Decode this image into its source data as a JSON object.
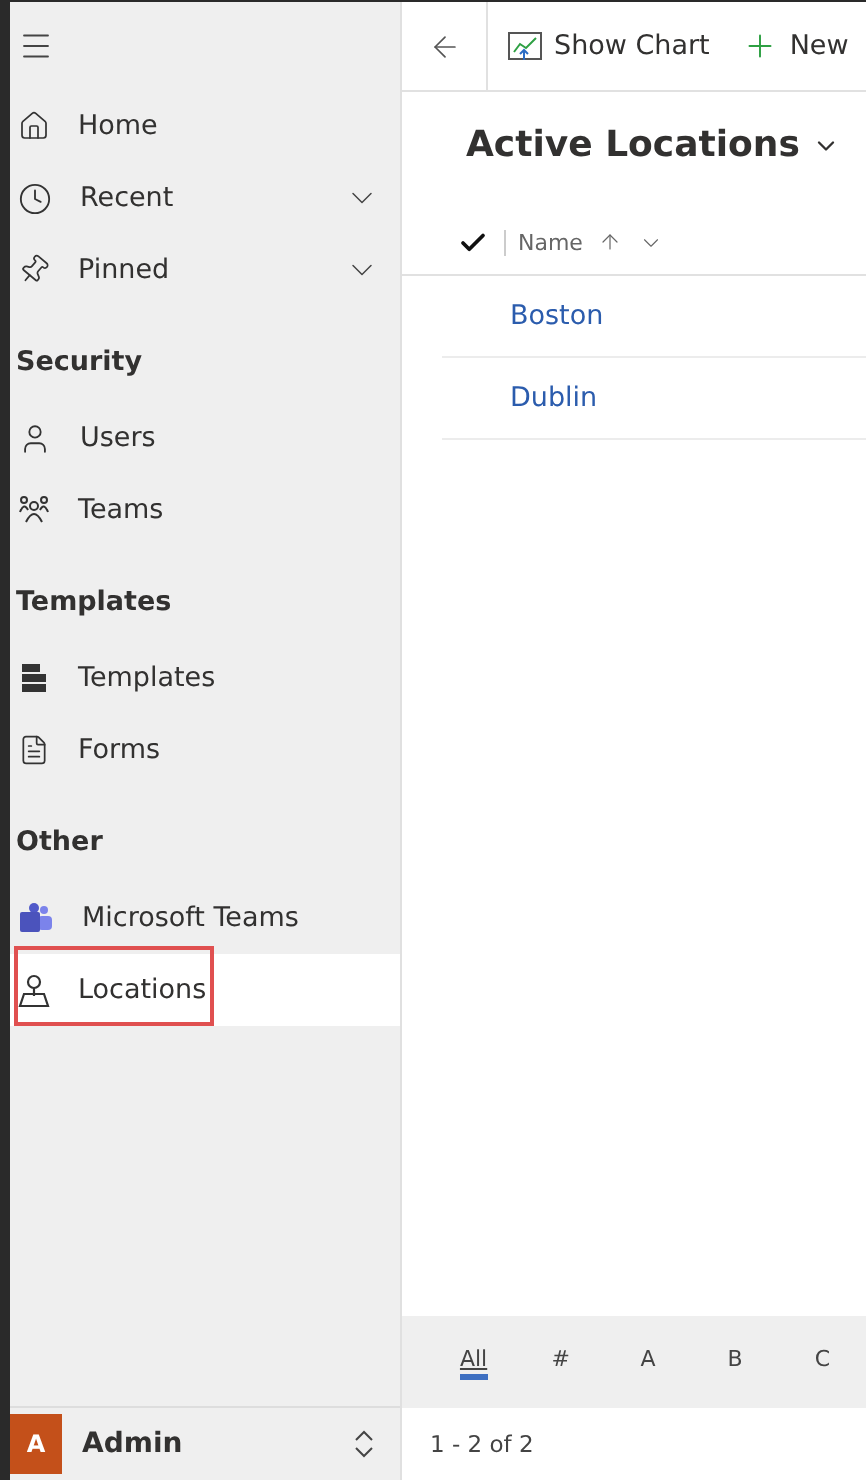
{
  "sidebar": {
    "entries": [
      {
        "kind": "link",
        "label": "Home",
        "selected": false
      },
      {
        "kind": "group",
        "label": "Recent",
        "selected": false,
        "expanded": false
      },
      {
        "kind": "group",
        "label": "Pinned",
        "selected": false,
        "expanded": false
      },
      {
        "kind": "header",
        "label": "Security"
      },
      {
        "kind": "link",
        "label": "Users",
        "selected": false
      },
      {
        "kind": "link",
        "label": "Teams",
        "selected": false
      },
      {
        "kind": "header",
        "label": "Templates"
      },
      {
        "kind": "link",
        "label": "Templates",
        "selected": false
      },
      {
        "kind": "link",
        "label": "Forms",
        "selected": false
      },
      {
        "kind": "header",
        "label": "Other"
      },
      {
        "kind": "link",
        "label": "Microsoft Teams",
        "selected": false
      },
      {
        "kind": "link",
        "label": "Locations",
        "selected": true,
        "highlighted": true
      }
    ],
    "user": {
      "initial": "A",
      "name": "Admin"
    }
  },
  "toolbar": {
    "buttons": [
      "Show Chart",
      "New"
    ]
  },
  "view": {
    "title": "Active Locations",
    "columns": [
      {
        "label": "Name"
      }
    ],
    "rows": [
      "Boston",
      "Dublin"
    ]
  },
  "jump_bar": [
    {
      "label": "All",
      "selected": true
    },
    {
      "label": "#",
      "selected": false
    },
    {
      "label": "A",
      "selected": false
    },
    {
      "label": "B",
      "selected": false
    },
    {
      "label": "C",
      "selected": false
    }
  ],
  "status": "1 - 2 of 2"
}
